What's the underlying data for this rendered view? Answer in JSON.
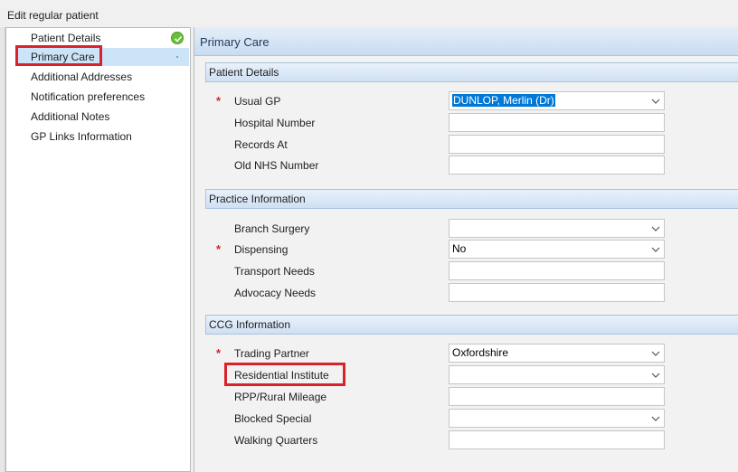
{
  "window": {
    "title": "Edit regular patient"
  },
  "nav": {
    "items": [
      {
        "label": "Patient Details"
      },
      {
        "label": "Primary Care"
      },
      {
        "label": "Additional Addresses"
      },
      {
        "label": "Notification preferences"
      },
      {
        "label": "Additional Notes"
      },
      {
        "label": "GP Links Information"
      }
    ]
  },
  "content": {
    "title": "Primary Care",
    "sections": [
      {
        "title": "Patient Details",
        "fields": [
          {
            "label": "Usual GP",
            "value": "DUNLOP, Merlin (Dr)",
            "type": "select",
            "required": true
          },
          {
            "label": "Hospital Number",
            "value": "",
            "type": "text"
          },
          {
            "label": "Records At",
            "value": "",
            "type": "text"
          },
          {
            "label": "Old NHS Number",
            "value": "",
            "type": "text"
          }
        ]
      },
      {
        "title": "Practice Information",
        "fields": [
          {
            "label": "Branch Surgery",
            "value": "",
            "type": "select"
          },
          {
            "label": "Dispensing",
            "value": "No",
            "type": "select",
            "required": true
          },
          {
            "label": "Transport Needs",
            "value": "",
            "type": "text"
          },
          {
            "label": "Advocacy Needs",
            "value": "",
            "type": "text"
          }
        ]
      },
      {
        "title": "CCG Information",
        "fields": [
          {
            "label": "Trading Partner",
            "value": "Oxfordshire",
            "type": "select",
            "required": true
          },
          {
            "label": "Residential Institute",
            "value": "",
            "type": "select"
          },
          {
            "label": "RPP/Rural Mileage",
            "value": "",
            "type": "text"
          },
          {
            "label": "Blocked Special",
            "value": "",
            "type": "select"
          },
          {
            "label": "Walking Quarters",
            "value": "",
            "type": "text"
          }
        ]
      }
    ]
  },
  "required_marker": "*",
  "colors": {
    "required": "#d9232b",
    "highlight_box": "#d9232b",
    "selected_nav": "#cce4f7",
    "selection": "#0078d7"
  }
}
